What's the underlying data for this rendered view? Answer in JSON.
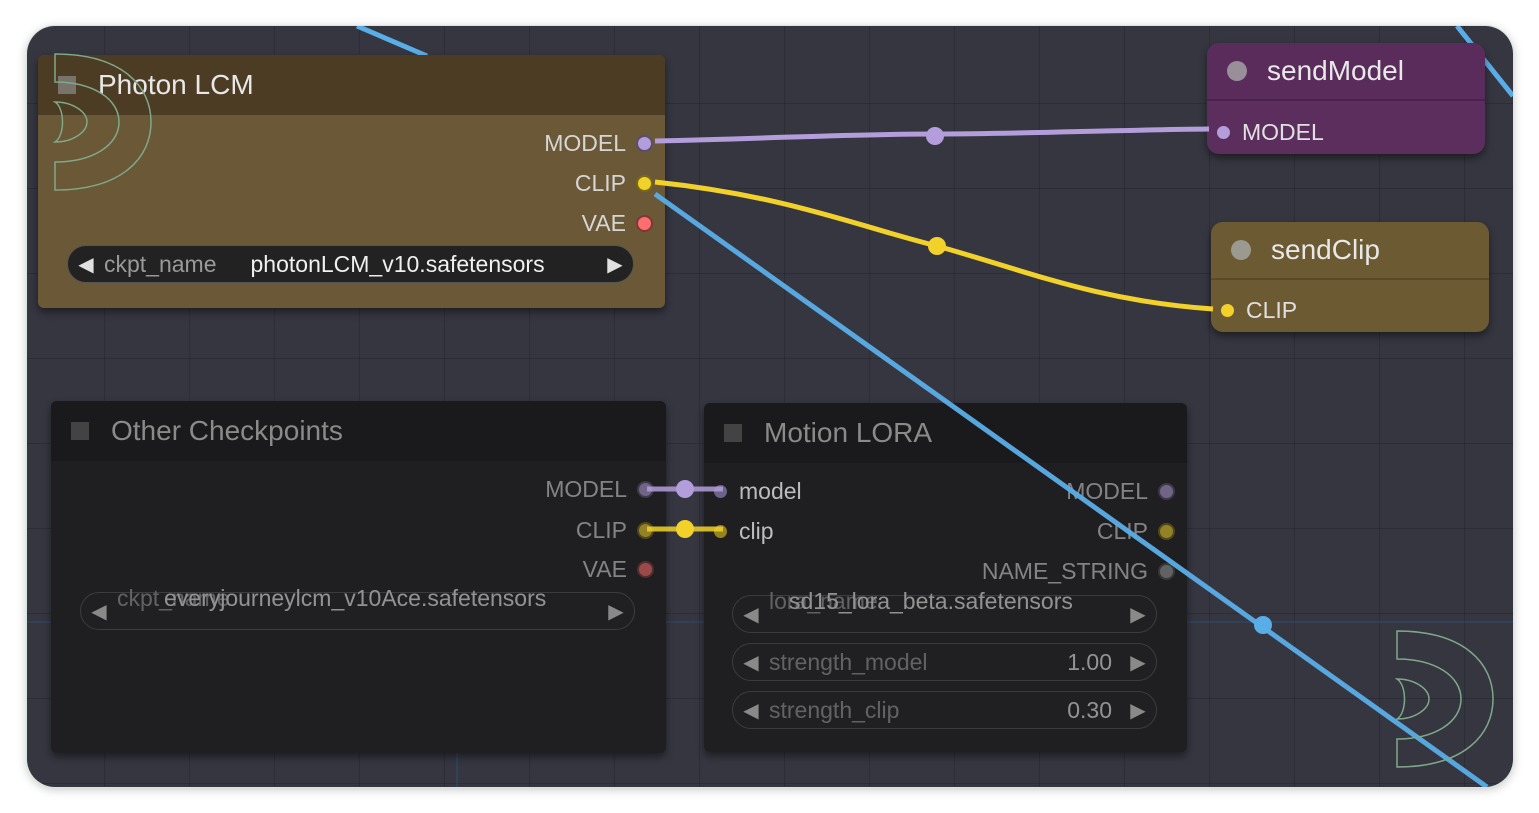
{
  "nodes": {
    "photon_lcm": {
      "title": "Photon LCM",
      "outputs": [
        "MODEL",
        "CLIP",
        "VAE"
      ],
      "widget": {
        "label": "ckpt_name",
        "value": "photonLCM_v10.safetensors"
      }
    },
    "other_checkpoints": {
      "title": "Other Checkpoints",
      "outputs": [
        "MODEL",
        "CLIP",
        "VAE"
      ],
      "widget": {
        "label": "ckpt_name",
        "value": "everyjourneylcm_v10Ace.safetensors",
        "label_overlap": "ckpt_"
      }
    },
    "motion_lora": {
      "title": "Motion LORA",
      "inputs": [
        "model",
        "clip"
      ],
      "outputs": [
        "MODEL",
        "CLIP",
        "NAME_STRING"
      ],
      "widgets": [
        {
          "label": "lora_name",
          "value": "sd15_lora_beta.safetensors",
          "label_overlap": "lo"
        },
        {
          "label": "strength_model",
          "value": "1.00"
        },
        {
          "label": "strength_clip",
          "value": "0.30"
        }
      ]
    },
    "send_model": {
      "title": "sendModel",
      "input": "MODEL"
    },
    "send_clip": {
      "title": "sendClip",
      "input": "CLIP"
    }
  },
  "colors": {
    "canvas": "#353640",
    "model_wire": "#b39ddb",
    "clip_wire": "#f2d22a",
    "vae_pin": "#ff6e6e",
    "blue_wire": "#5aaee8",
    "photon_body": "#6b5836",
    "photon_title": "#4d3c24",
    "send_model_body": "#5b2e5e",
    "send_clip_body": "#6b5a32"
  }
}
